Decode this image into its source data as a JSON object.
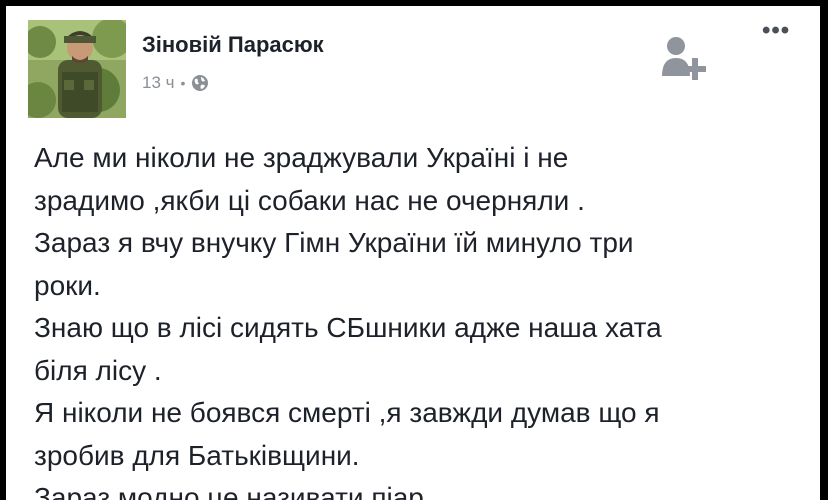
{
  "post": {
    "author": "Зіновій Парасюк",
    "time": "13 ч",
    "separator": "•",
    "privacy_icon": "globe-icon",
    "add_friend_icon": "add-friend-icon",
    "more_icon": "more-options-icon",
    "more_label": "•••",
    "lines": [
      "Але ми ніколи не зраджували Україні  і не",
      "зрадимо ,якби ці собаки нас не очерняли .",
      "Зараз я вчу внучку Гімн України їй минуло три",
      "роки.",
      "Знаю що в лісі сидять СБшники адже наша хата",
      "біля лісу .",
      "Я ніколи не боявся смерті ,я завжди думав що я",
      "зробив для Батьківщини.",
      "Зараз модно це називати піар."
    ]
  }
}
